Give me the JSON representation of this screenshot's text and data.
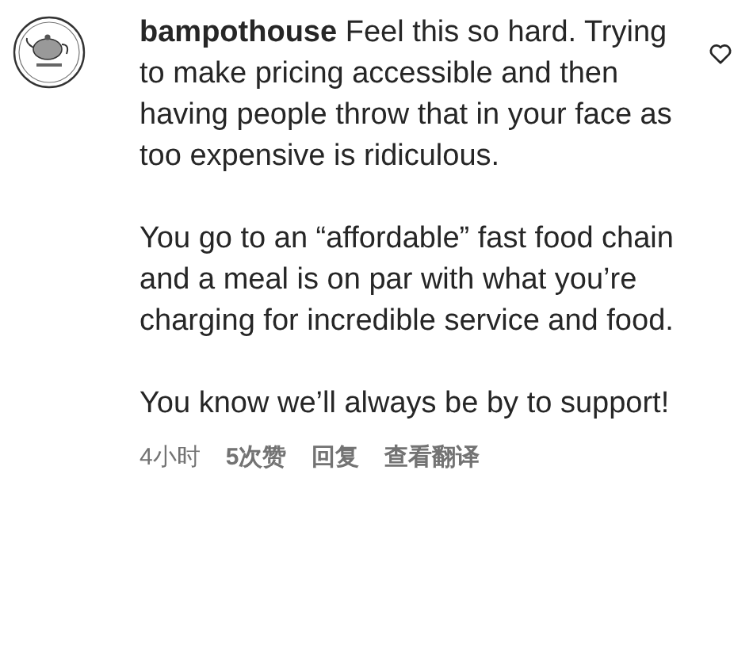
{
  "comment": {
    "username": "bampothouse",
    "paragraphs": [
      "Feel this so hard. Trying to make pricing accessible and then having people throw that in your face as too expensive is ridiculous.",
      "You go to an “affordable” fast food chain and a meal is on par with what you’re charging for incredible service and food.",
      "You know we’ll always be by to support!"
    ],
    "liked": false
  },
  "meta": {
    "time": "4小时",
    "likes": "5次赞",
    "reply": "回复",
    "translate": "查看翻译"
  }
}
